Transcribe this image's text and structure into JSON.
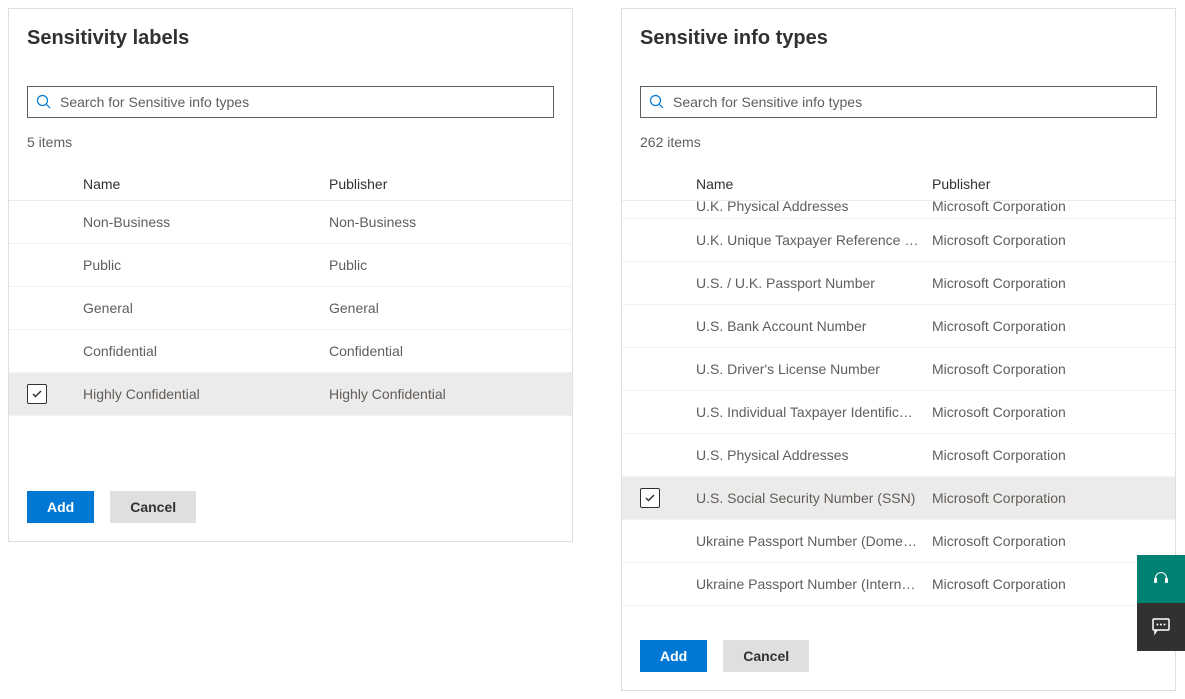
{
  "left": {
    "title": "Sensitivity labels",
    "search_placeholder": "Search for Sensitive info types",
    "item_count": "5 items",
    "columns": {
      "name": "Name",
      "publisher": "Publisher"
    },
    "rows": [
      {
        "name": "Non-Business",
        "publisher": "Non-Business",
        "selected": false
      },
      {
        "name": "Public",
        "publisher": "Public",
        "selected": false
      },
      {
        "name": "General",
        "publisher": "General",
        "selected": false
      },
      {
        "name": "Confidential",
        "publisher": "Confidential",
        "selected": false
      },
      {
        "name": "Highly Confidential",
        "publisher": "Highly Confidential",
        "selected": true
      }
    ],
    "add_label": "Add",
    "cancel_label": "Cancel"
  },
  "right": {
    "title": "Sensitive info types",
    "search_placeholder": "Search for Sensitive info types",
    "item_count": "262 items",
    "columns": {
      "name": "Name",
      "publisher": "Publisher"
    },
    "partial_row": {
      "name": "U.K. Physical Addresses",
      "publisher": "Microsoft Corporation"
    },
    "rows": [
      {
        "name": "U.K. Unique Taxpayer Reference Number",
        "publisher": "Microsoft Corporation",
        "selected": false
      },
      {
        "name": "U.S. / U.K. Passport Number",
        "publisher": "Microsoft Corporation",
        "selected": false
      },
      {
        "name": "U.S. Bank Account Number",
        "publisher": "Microsoft Corporation",
        "selected": false
      },
      {
        "name": "U.S. Driver's License Number",
        "publisher": "Microsoft Corporation",
        "selected": false
      },
      {
        "name": "U.S. Individual Taxpayer Identification N...",
        "publisher": "Microsoft Corporation",
        "selected": false
      },
      {
        "name": "U.S. Physical Addresses",
        "publisher": "Microsoft Corporation",
        "selected": false
      },
      {
        "name": "U.S. Social Security Number (SSN)",
        "publisher": "Microsoft Corporation",
        "selected": true
      },
      {
        "name": "Ukraine Passport Number (Domestic)",
        "publisher": "Microsoft Corporation",
        "selected": false
      },
      {
        "name": "Ukraine Passport Number (International)",
        "publisher": "Microsoft Corporation",
        "selected": false
      }
    ],
    "add_label": "Add",
    "cancel_label": "Cancel"
  }
}
